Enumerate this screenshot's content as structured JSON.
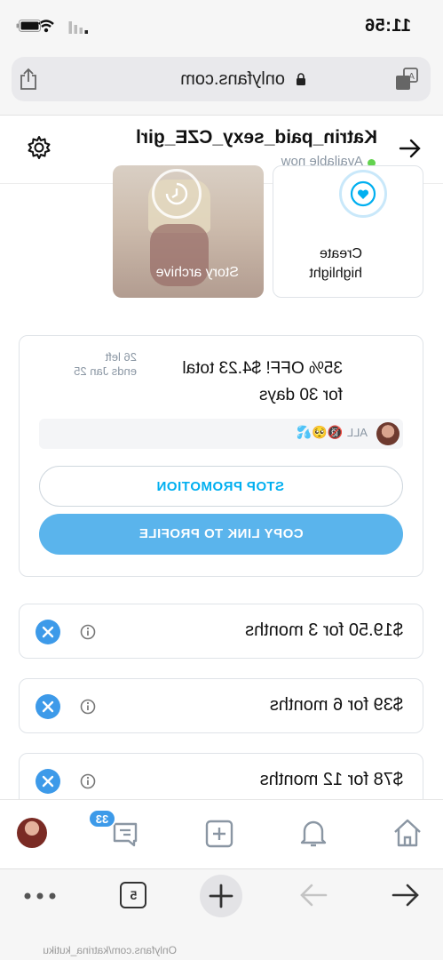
{
  "status_bar": {
    "time": "11:56"
  },
  "browser": {
    "url": "onlyfans.com"
  },
  "profile": {
    "username": "Katrin_paid_sexy_CZE_girl",
    "availability": "Available now"
  },
  "highlights": {
    "create_label": "Create highlight",
    "archive_label": "Story archive"
  },
  "promotion": {
    "title": "35% OFF! $4.23 total for 30 days",
    "left": "26 left",
    "ends": "ends Jan 25",
    "audience": "ALL",
    "audience_emoji": "🔞🥺💦",
    "stop_label": "STOP PROMOTION",
    "copy_label": "COPY LINK TO PROFILE"
  },
  "bundles": [
    {
      "label": "$19.50 for 3 months"
    },
    {
      "label": "$39 for 6 months"
    },
    {
      "label": "$78 for 12 months"
    }
  ],
  "nav": {
    "messages_badge": "33"
  },
  "toolbar": {
    "tabs_count": "5"
  },
  "watermark": "Onlyfans.com/katrina_kutiku",
  "colors": {
    "accent": "#00aff0",
    "button_blue": "#5ab4ec",
    "online_green": "#63d34f"
  },
  "icons": [
    "share-icon",
    "lock-icon",
    "translate-icon",
    "back-icon",
    "settings-icon",
    "heart-icon",
    "info-icon",
    "close-icon",
    "home-icon",
    "bell-icon",
    "plus-icon",
    "message-icon",
    "arrow-left-icon",
    "arrow-right-icon",
    "tabs-icon",
    "more-icon"
  ]
}
